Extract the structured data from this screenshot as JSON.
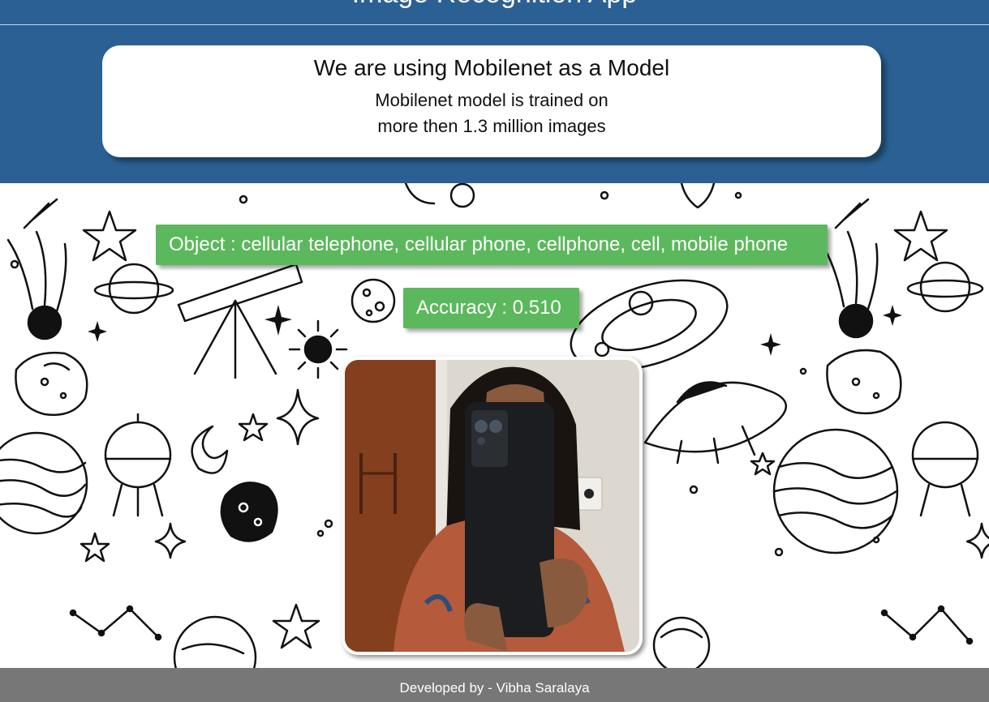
{
  "header": {
    "title": "Image Recognition App",
    "card": {
      "title": "We are using Mobilenet as a Model",
      "line1": "Mobilenet model is trained on",
      "line2": "more then 1.3 million images"
    }
  },
  "results": {
    "object_text": "Object : cellular telephone, cellular phone, cellphone, cell, mobile phone",
    "accuracy_text": "Accuracy : 0.510"
  },
  "camera": {
    "label": "webcam-feed"
  },
  "footer": {
    "credit": "Developed by - Vibha Saralaya"
  },
  "colors": {
    "header_bg": "#2a6093",
    "result_pill": "#5cb85c",
    "footer_bg": "#777777"
  }
}
